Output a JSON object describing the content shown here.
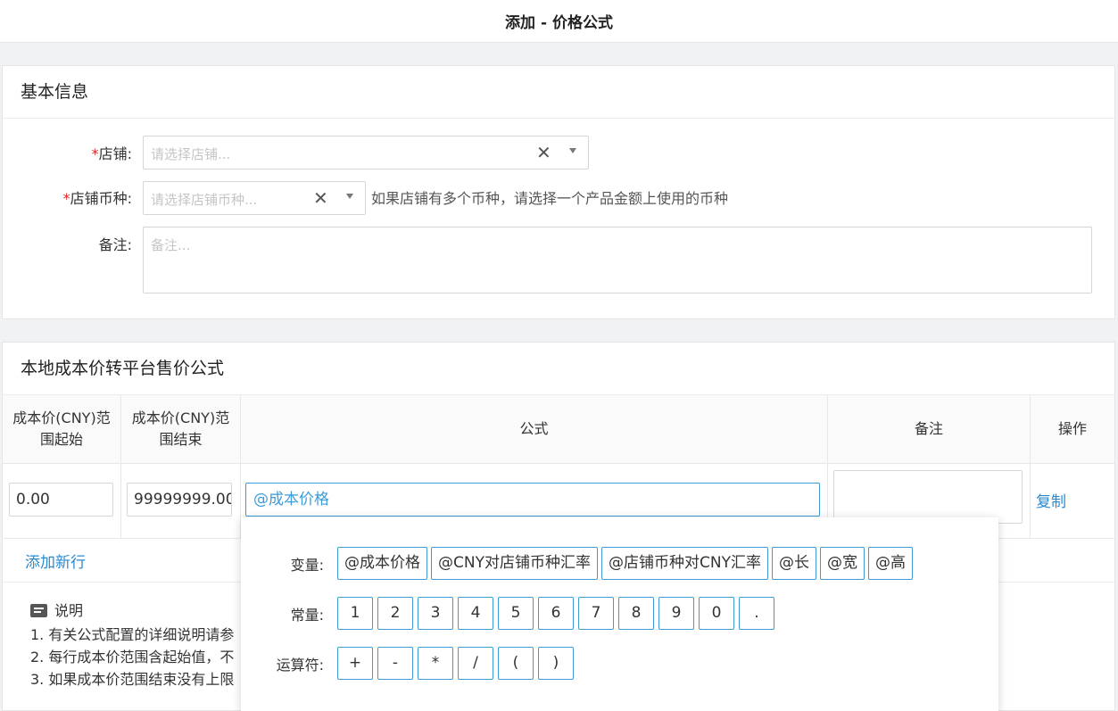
{
  "page_title": "添加 - 价格公式",
  "basic_info": {
    "title": "基本信息",
    "store_label": "店铺:",
    "store_placeholder": "请选择店铺...",
    "currency_label": "店铺币种:",
    "currency_placeholder": "请选择店铺币种...",
    "currency_hint": "如果店铺有多个币种，请选择一个产品金额上使用的币种",
    "remark_label": "备注:",
    "remark_placeholder": "备注...",
    "required_mark": "*"
  },
  "formula_section": {
    "title": "本地成本价转平台售价公式",
    "columns": {
      "start": "成本价(CNY)范围起始",
      "end": "成本价(CNY)范围结束",
      "formula": "公式",
      "remark": "备注",
      "action": "操作"
    },
    "rows": [
      {
        "start": "0.00",
        "end": "99999999.00",
        "formula": "@成本价格",
        "remark": "",
        "action": "复制"
      }
    ],
    "add_row": "添加新行"
  },
  "popup": {
    "variables_label": "变量:",
    "variables": [
      "@成本价格",
      "@CNY对店铺币种汇率",
      "@店铺币种对CNY汇率",
      "@长",
      "@宽",
      "@高"
    ],
    "constants_label": "常量:",
    "constants": [
      "1",
      "2",
      "3",
      "4",
      "5",
      "6",
      "7",
      "8",
      "9",
      "0",
      "."
    ],
    "operators_label": "运算符:",
    "operators": [
      "+",
      "-",
      "*",
      "/",
      "(",
      ")"
    ]
  },
  "notes": {
    "title": "说明",
    "lines": [
      "1. 有关公式配置的详细说明请参",
      "2. 每行成本价范围含起始值，不",
      "3. 如果成本价范围结束没有上限"
    ]
  }
}
